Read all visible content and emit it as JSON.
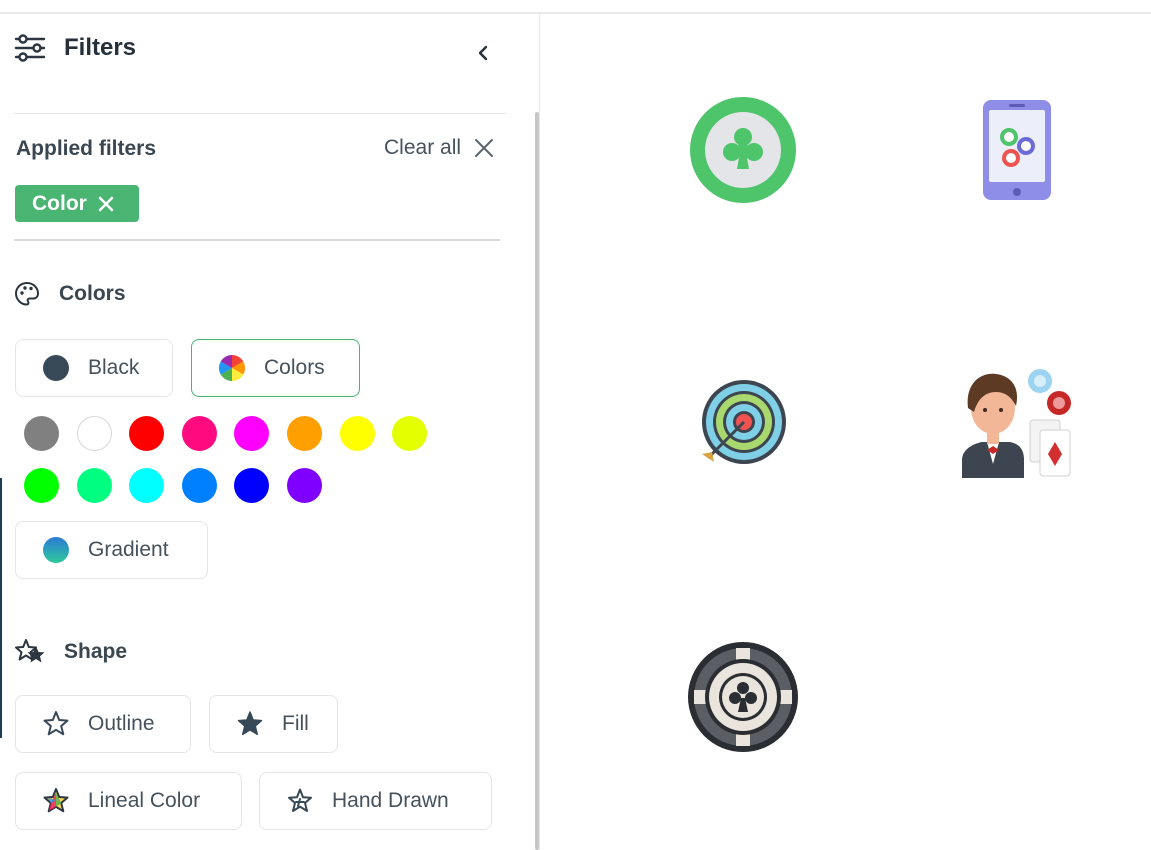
{
  "sidebar": {
    "title": "Filters",
    "applied_filters": {
      "title": "Applied filters",
      "clear_label": "Clear all",
      "chips": [
        {
          "label": "Color"
        }
      ]
    },
    "colors": {
      "title": "Colors",
      "options": [
        {
          "label": "Black"
        },
        {
          "label": "Colors"
        }
      ],
      "swatches": [
        {
          "color": "#808080"
        },
        {
          "color": "#ffffff"
        },
        {
          "color": "#ff0000"
        },
        {
          "color": "#ff0b7f"
        },
        {
          "color": "#ff00ff"
        },
        {
          "color": "#ff9f00"
        },
        {
          "color": "#ffff00"
        },
        {
          "color": "#e4ff00"
        },
        {
          "color": "#00ff00"
        },
        {
          "color": "#00ff80"
        },
        {
          "color": "#00ffff"
        },
        {
          "color": "#0080ff"
        },
        {
          "color": "#0000ff"
        },
        {
          "color": "#8000ff"
        }
      ],
      "gradient_label": "Gradient"
    },
    "shape": {
      "title": "Shape",
      "options": [
        {
          "label": "Outline"
        },
        {
          "label": "Fill"
        },
        {
          "label": "Lineal Color"
        },
        {
          "label": "Hand Drawn"
        }
      ]
    }
  },
  "results": [
    {
      "icon": "club-badge-icon"
    },
    {
      "icon": "mobile-casino-chips-icon"
    },
    {
      "icon": "dartboard-target-icon"
    },
    {
      "icon": "croupier-icon"
    },
    {
      "icon": "poker-chip-club-icon"
    }
  ],
  "colors": {
    "accent": "#4ab472",
    "text": "#374957"
  }
}
